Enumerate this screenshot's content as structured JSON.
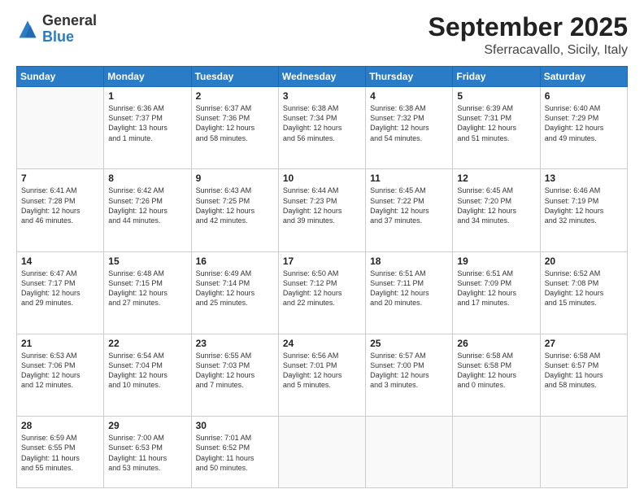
{
  "header": {
    "logo_general": "General",
    "logo_blue": "Blue",
    "title": "September 2025",
    "location": "Sferracavallo, Sicily, Italy"
  },
  "days_of_week": [
    "Sunday",
    "Monday",
    "Tuesday",
    "Wednesday",
    "Thursday",
    "Friday",
    "Saturday"
  ],
  "weeks": [
    [
      {
        "day": "",
        "content": ""
      },
      {
        "day": "1",
        "content": "Sunrise: 6:36 AM\nSunset: 7:37 PM\nDaylight: 13 hours\nand 1 minute."
      },
      {
        "day": "2",
        "content": "Sunrise: 6:37 AM\nSunset: 7:36 PM\nDaylight: 12 hours\nand 58 minutes."
      },
      {
        "day": "3",
        "content": "Sunrise: 6:38 AM\nSunset: 7:34 PM\nDaylight: 12 hours\nand 56 minutes."
      },
      {
        "day": "4",
        "content": "Sunrise: 6:38 AM\nSunset: 7:32 PM\nDaylight: 12 hours\nand 54 minutes."
      },
      {
        "day": "5",
        "content": "Sunrise: 6:39 AM\nSunset: 7:31 PM\nDaylight: 12 hours\nand 51 minutes."
      },
      {
        "day": "6",
        "content": "Sunrise: 6:40 AM\nSunset: 7:29 PM\nDaylight: 12 hours\nand 49 minutes."
      }
    ],
    [
      {
        "day": "7",
        "content": "Sunrise: 6:41 AM\nSunset: 7:28 PM\nDaylight: 12 hours\nand 46 minutes."
      },
      {
        "day": "8",
        "content": "Sunrise: 6:42 AM\nSunset: 7:26 PM\nDaylight: 12 hours\nand 44 minutes."
      },
      {
        "day": "9",
        "content": "Sunrise: 6:43 AM\nSunset: 7:25 PM\nDaylight: 12 hours\nand 42 minutes."
      },
      {
        "day": "10",
        "content": "Sunrise: 6:44 AM\nSunset: 7:23 PM\nDaylight: 12 hours\nand 39 minutes."
      },
      {
        "day": "11",
        "content": "Sunrise: 6:45 AM\nSunset: 7:22 PM\nDaylight: 12 hours\nand 37 minutes."
      },
      {
        "day": "12",
        "content": "Sunrise: 6:45 AM\nSunset: 7:20 PM\nDaylight: 12 hours\nand 34 minutes."
      },
      {
        "day": "13",
        "content": "Sunrise: 6:46 AM\nSunset: 7:19 PM\nDaylight: 12 hours\nand 32 minutes."
      }
    ],
    [
      {
        "day": "14",
        "content": "Sunrise: 6:47 AM\nSunset: 7:17 PM\nDaylight: 12 hours\nand 29 minutes."
      },
      {
        "day": "15",
        "content": "Sunrise: 6:48 AM\nSunset: 7:15 PM\nDaylight: 12 hours\nand 27 minutes."
      },
      {
        "day": "16",
        "content": "Sunrise: 6:49 AM\nSunset: 7:14 PM\nDaylight: 12 hours\nand 25 minutes."
      },
      {
        "day": "17",
        "content": "Sunrise: 6:50 AM\nSunset: 7:12 PM\nDaylight: 12 hours\nand 22 minutes."
      },
      {
        "day": "18",
        "content": "Sunrise: 6:51 AM\nSunset: 7:11 PM\nDaylight: 12 hours\nand 20 minutes."
      },
      {
        "day": "19",
        "content": "Sunrise: 6:51 AM\nSunset: 7:09 PM\nDaylight: 12 hours\nand 17 minutes."
      },
      {
        "day": "20",
        "content": "Sunrise: 6:52 AM\nSunset: 7:08 PM\nDaylight: 12 hours\nand 15 minutes."
      }
    ],
    [
      {
        "day": "21",
        "content": "Sunrise: 6:53 AM\nSunset: 7:06 PM\nDaylight: 12 hours\nand 12 minutes."
      },
      {
        "day": "22",
        "content": "Sunrise: 6:54 AM\nSunset: 7:04 PM\nDaylight: 12 hours\nand 10 minutes."
      },
      {
        "day": "23",
        "content": "Sunrise: 6:55 AM\nSunset: 7:03 PM\nDaylight: 12 hours\nand 7 minutes."
      },
      {
        "day": "24",
        "content": "Sunrise: 6:56 AM\nSunset: 7:01 PM\nDaylight: 12 hours\nand 5 minutes."
      },
      {
        "day": "25",
        "content": "Sunrise: 6:57 AM\nSunset: 7:00 PM\nDaylight: 12 hours\nand 3 minutes."
      },
      {
        "day": "26",
        "content": "Sunrise: 6:58 AM\nSunset: 6:58 PM\nDaylight: 12 hours\nand 0 minutes."
      },
      {
        "day": "27",
        "content": "Sunrise: 6:58 AM\nSunset: 6:57 PM\nDaylight: 11 hours\nand 58 minutes."
      }
    ],
    [
      {
        "day": "28",
        "content": "Sunrise: 6:59 AM\nSunset: 6:55 PM\nDaylight: 11 hours\nand 55 minutes."
      },
      {
        "day": "29",
        "content": "Sunrise: 7:00 AM\nSunset: 6:53 PM\nDaylight: 11 hours\nand 53 minutes."
      },
      {
        "day": "30",
        "content": "Sunrise: 7:01 AM\nSunset: 6:52 PM\nDaylight: 11 hours\nand 50 minutes."
      },
      {
        "day": "",
        "content": ""
      },
      {
        "day": "",
        "content": ""
      },
      {
        "day": "",
        "content": ""
      },
      {
        "day": "",
        "content": ""
      }
    ]
  ]
}
